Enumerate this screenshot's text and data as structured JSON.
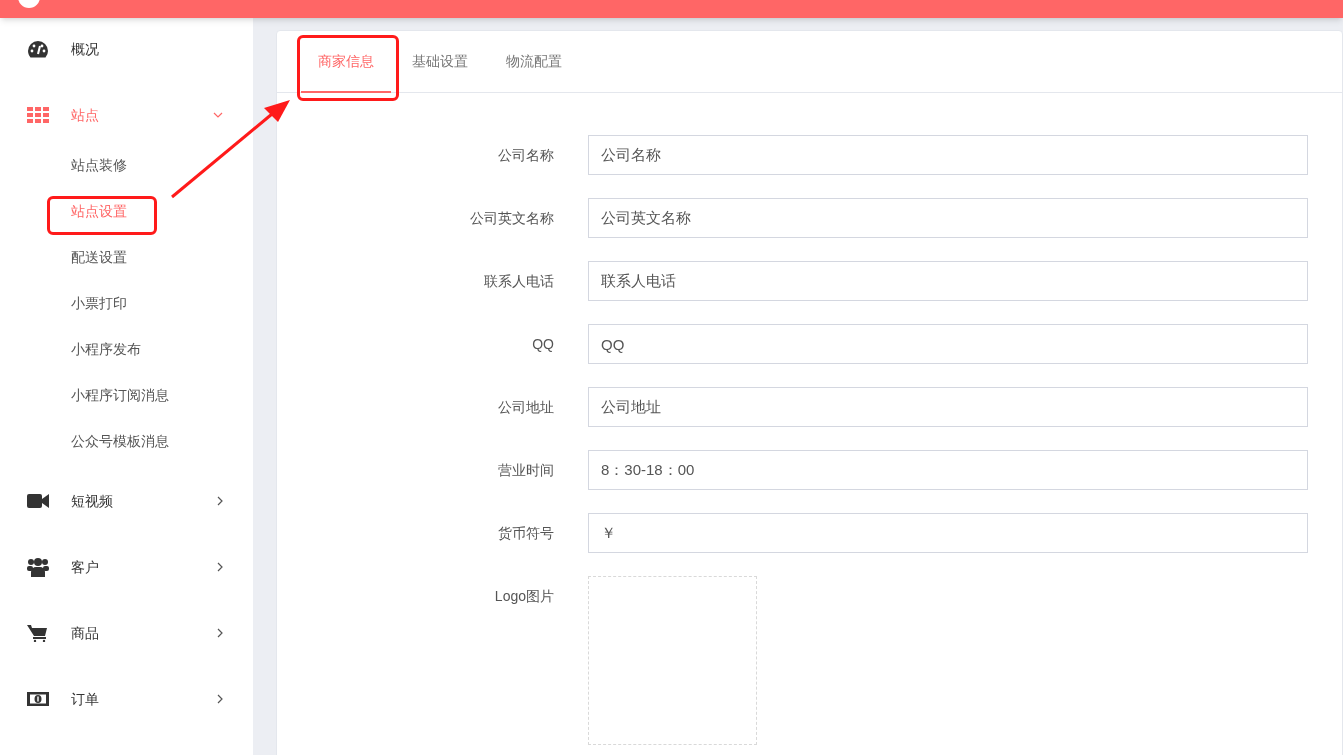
{
  "sidebar": {
    "items": [
      {
        "label": "概况",
        "selected": false
      },
      {
        "label": "站点",
        "selected": true,
        "expanded": true,
        "children": [
          {
            "label": "站点装修",
            "selected": false
          },
          {
            "label": "站点设置",
            "selected": true
          },
          {
            "label": "配送设置",
            "selected": false
          },
          {
            "label": "小票打印",
            "selected": false
          },
          {
            "label": "小程序发布",
            "selected": false
          },
          {
            "label": "小程序订阅消息",
            "selected": false
          },
          {
            "label": "公众号模板消息",
            "selected": false
          }
        ]
      },
      {
        "label": "短视频",
        "selected": false,
        "expanded": false
      },
      {
        "label": "客户",
        "selected": false,
        "expanded": false
      },
      {
        "label": "商品",
        "selected": false,
        "expanded": false
      },
      {
        "label": "订单",
        "selected": false,
        "expanded": false
      }
    ]
  },
  "tabs": [
    {
      "label": "商家信息",
      "selected": true
    },
    {
      "label": "基础设置",
      "selected": false
    },
    {
      "label": "物流配置",
      "selected": false
    }
  ],
  "form": {
    "fields": [
      {
        "kind": "text",
        "label": "公司名称",
        "value": "公司名称"
      },
      {
        "kind": "text",
        "label": "公司英文名称",
        "value": "公司英文名称"
      },
      {
        "kind": "text",
        "label": "联系人电话",
        "value": "联系人电话"
      },
      {
        "kind": "text",
        "label": "QQ",
        "value": "QQ"
      },
      {
        "kind": "text",
        "label": "公司地址",
        "value": "公司地址"
      },
      {
        "kind": "text",
        "label": "营业时间",
        "value": "8：30-18：00"
      },
      {
        "kind": "text",
        "label": "货币符号",
        "value": "￥"
      },
      {
        "kind": "upload",
        "label": "Logo图片"
      }
    ]
  }
}
